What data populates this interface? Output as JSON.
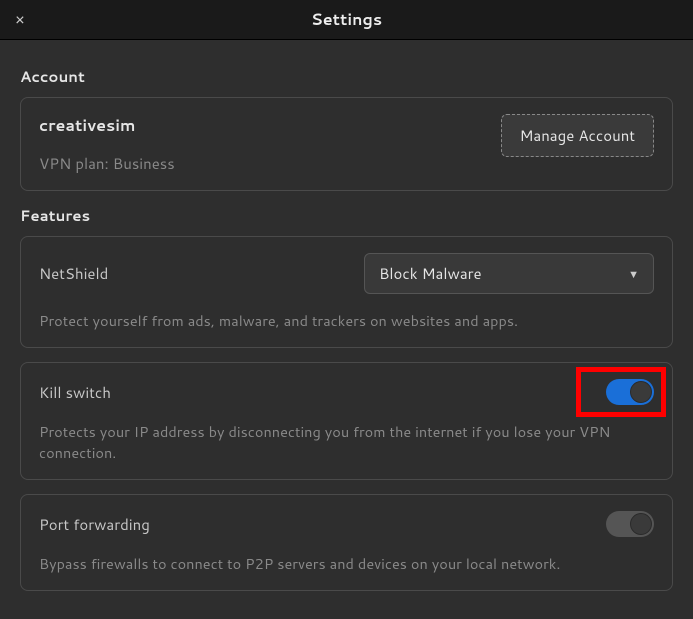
{
  "window": {
    "title": "Settings"
  },
  "sections": {
    "account_label": "Account",
    "features_label": "Features"
  },
  "account": {
    "username": "creativesim",
    "plan": "VPN plan: Business",
    "manage_button": "Manage Account"
  },
  "netshield": {
    "title": "NetShield",
    "selected": "Block Malware",
    "description": "Protect yourself from ads, malware, and trackers on websites and apps."
  },
  "killswitch": {
    "title": "Kill switch",
    "description": "Protects your IP address by disconnecting you from the internet if you lose your VPN connection.",
    "enabled": true
  },
  "portforwarding": {
    "title": "Port forwarding",
    "description": "Bypass firewalls to connect to P2P servers and devices on your local network.",
    "enabled": false
  }
}
